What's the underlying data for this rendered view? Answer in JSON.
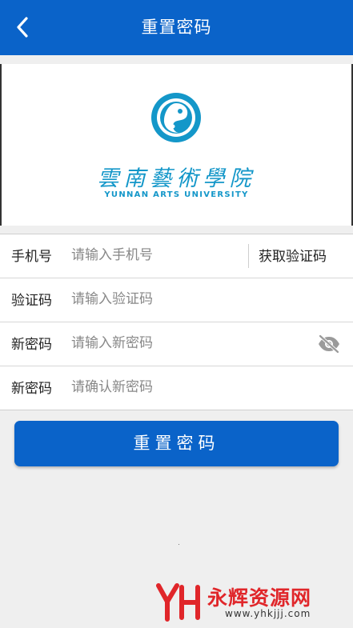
{
  "header": {
    "title": "重置密码",
    "back_icon": "chevron-left-icon",
    "background": "#0a63c9"
  },
  "logo": {
    "name_cn": "雲南藝術學院",
    "name_en": "YUNNAN ARTS UNIVERSITY",
    "color": "#1497c9"
  },
  "form": {
    "phone": {
      "label": "手机号",
      "placeholder": "请输入手机号",
      "value": ""
    },
    "get_code_label": "获取验证码",
    "code": {
      "label": "验证码",
      "placeholder": "请输入验证码",
      "value": ""
    },
    "new_password": {
      "label": "新密码",
      "placeholder": "请输入新密码",
      "value": "",
      "toggle_icon": "eye-off-icon"
    },
    "confirm_password": {
      "label": "新密码",
      "placeholder": "请确认新密码",
      "value": ""
    }
  },
  "submit_label": "重置密码",
  "watermark": {
    "name": "永辉资源网",
    "url": "www.yhkjjj.com",
    "color": "#e0262a"
  }
}
